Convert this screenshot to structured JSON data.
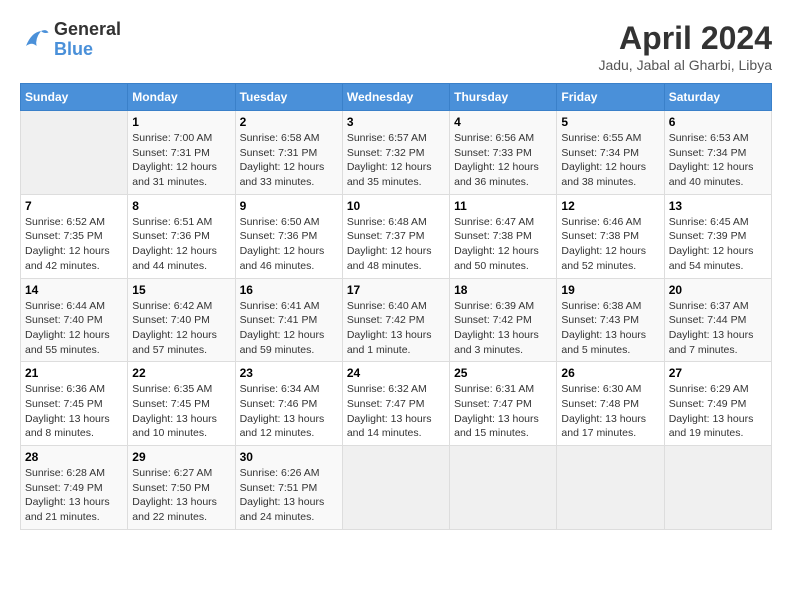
{
  "header": {
    "logo_text_general": "General",
    "logo_text_blue": "Blue",
    "month_year": "April 2024",
    "location": "Jadu, Jabal al Gharbi, Libya"
  },
  "weekdays": [
    "Sunday",
    "Monday",
    "Tuesday",
    "Wednesday",
    "Thursday",
    "Friday",
    "Saturday"
  ],
  "weeks": [
    [
      {
        "day": "",
        "sunrise": "",
        "sunset": "",
        "daylight": ""
      },
      {
        "day": "1",
        "sunrise": "Sunrise: 7:00 AM",
        "sunset": "Sunset: 7:31 PM",
        "daylight": "Daylight: 12 hours and 31 minutes."
      },
      {
        "day": "2",
        "sunrise": "Sunrise: 6:58 AM",
        "sunset": "Sunset: 7:31 PM",
        "daylight": "Daylight: 12 hours and 33 minutes."
      },
      {
        "day": "3",
        "sunrise": "Sunrise: 6:57 AM",
        "sunset": "Sunset: 7:32 PM",
        "daylight": "Daylight: 12 hours and 35 minutes."
      },
      {
        "day": "4",
        "sunrise": "Sunrise: 6:56 AM",
        "sunset": "Sunset: 7:33 PM",
        "daylight": "Daylight: 12 hours and 36 minutes."
      },
      {
        "day": "5",
        "sunrise": "Sunrise: 6:55 AM",
        "sunset": "Sunset: 7:34 PM",
        "daylight": "Daylight: 12 hours and 38 minutes."
      },
      {
        "day": "6",
        "sunrise": "Sunrise: 6:53 AM",
        "sunset": "Sunset: 7:34 PM",
        "daylight": "Daylight: 12 hours and 40 minutes."
      }
    ],
    [
      {
        "day": "7",
        "sunrise": "Sunrise: 6:52 AM",
        "sunset": "Sunset: 7:35 PM",
        "daylight": "Daylight: 12 hours and 42 minutes."
      },
      {
        "day": "8",
        "sunrise": "Sunrise: 6:51 AM",
        "sunset": "Sunset: 7:36 PM",
        "daylight": "Daylight: 12 hours and 44 minutes."
      },
      {
        "day": "9",
        "sunrise": "Sunrise: 6:50 AM",
        "sunset": "Sunset: 7:36 PM",
        "daylight": "Daylight: 12 hours and 46 minutes."
      },
      {
        "day": "10",
        "sunrise": "Sunrise: 6:48 AM",
        "sunset": "Sunset: 7:37 PM",
        "daylight": "Daylight: 12 hours and 48 minutes."
      },
      {
        "day": "11",
        "sunrise": "Sunrise: 6:47 AM",
        "sunset": "Sunset: 7:38 PM",
        "daylight": "Daylight: 12 hours and 50 minutes."
      },
      {
        "day": "12",
        "sunrise": "Sunrise: 6:46 AM",
        "sunset": "Sunset: 7:38 PM",
        "daylight": "Daylight: 12 hours and 52 minutes."
      },
      {
        "day": "13",
        "sunrise": "Sunrise: 6:45 AM",
        "sunset": "Sunset: 7:39 PM",
        "daylight": "Daylight: 12 hours and 54 minutes."
      }
    ],
    [
      {
        "day": "14",
        "sunrise": "Sunrise: 6:44 AM",
        "sunset": "Sunset: 7:40 PM",
        "daylight": "Daylight: 12 hours and 55 minutes."
      },
      {
        "day": "15",
        "sunrise": "Sunrise: 6:42 AM",
        "sunset": "Sunset: 7:40 PM",
        "daylight": "Daylight: 12 hours and 57 minutes."
      },
      {
        "day": "16",
        "sunrise": "Sunrise: 6:41 AM",
        "sunset": "Sunset: 7:41 PM",
        "daylight": "Daylight: 12 hours and 59 minutes."
      },
      {
        "day": "17",
        "sunrise": "Sunrise: 6:40 AM",
        "sunset": "Sunset: 7:42 PM",
        "daylight": "Daylight: 13 hours and 1 minute."
      },
      {
        "day": "18",
        "sunrise": "Sunrise: 6:39 AM",
        "sunset": "Sunset: 7:42 PM",
        "daylight": "Daylight: 13 hours and 3 minutes."
      },
      {
        "day": "19",
        "sunrise": "Sunrise: 6:38 AM",
        "sunset": "Sunset: 7:43 PM",
        "daylight": "Daylight: 13 hours and 5 minutes."
      },
      {
        "day": "20",
        "sunrise": "Sunrise: 6:37 AM",
        "sunset": "Sunset: 7:44 PM",
        "daylight": "Daylight: 13 hours and 7 minutes."
      }
    ],
    [
      {
        "day": "21",
        "sunrise": "Sunrise: 6:36 AM",
        "sunset": "Sunset: 7:45 PM",
        "daylight": "Daylight: 13 hours and 8 minutes."
      },
      {
        "day": "22",
        "sunrise": "Sunrise: 6:35 AM",
        "sunset": "Sunset: 7:45 PM",
        "daylight": "Daylight: 13 hours and 10 minutes."
      },
      {
        "day": "23",
        "sunrise": "Sunrise: 6:34 AM",
        "sunset": "Sunset: 7:46 PM",
        "daylight": "Daylight: 13 hours and 12 minutes."
      },
      {
        "day": "24",
        "sunrise": "Sunrise: 6:32 AM",
        "sunset": "Sunset: 7:47 PM",
        "daylight": "Daylight: 13 hours and 14 minutes."
      },
      {
        "day": "25",
        "sunrise": "Sunrise: 6:31 AM",
        "sunset": "Sunset: 7:47 PM",
        "daylight": "Daylight: 13 hours and 15 minutes."
      },
      {
        "day": "26",
        "sunrise": "Sunrise: 6:30 AM",
        "sunset": "Sunset: 7:48 PM",
        "daylight": "Daylight: 13 hours and 17 minutes."
      },
      {
        "day": "27",
        "sunrise": "Sunrise: 6:29 AM",
        "sunset": "Sunset: 7:49 PM",
        "daylight": "Daylight: 13 hours and 19 minutes."
      }
    ],
    [
      {
        "day": "28",
        "sunrise": "Sunrise: 6:28 AM",
        "sunset": "Sunset: 7:49 PM",
        "daylight": "Daylight: 13 hours and 21 minutes."
      },
      {
        "day": "29",
        "sunrise": "Sunrise: 6:27 AM",
        "sunset": "Sunset: 7:50 PM",
        "daylight": "Daylight: 13 hours and 22 minutes."
      },
      {
        "day": "30",
        "sunrise": "Sunrise: 6:26 AM",
        "sunset": "Sunset: 7:51 PM",
        "daylight": "Daylight: 13 hours and 24 minutes."
      },
      {
        "day": "",
        "sunrise": "",
        "sunset": "",
        "daylight": ""
      },
      {
        "day": "",
        "sunrise": "",
        "sunset": "",
        "daylight": ""
      },
      {
        "day": "",
        "sunrise": "",
        "sunset": "",
        "daylight": ""
      },
      {
        "day": "",
        "sunrise": "",
        "sunset": "",
        "daylight": ""
      }
    ]
  ]
}
